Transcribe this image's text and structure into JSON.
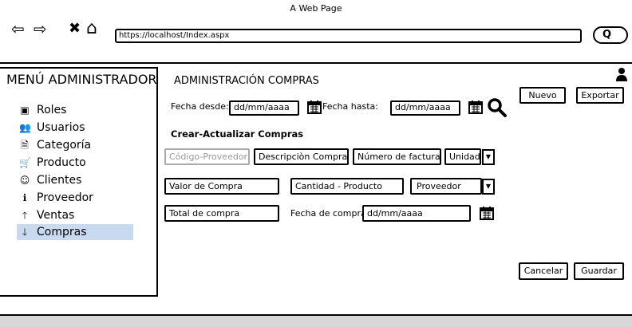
{
  "browser": {
    "title": "A Web Page",
    "url": "https://localhost/Index.aspx",
    "back_icon": "⇦",
    "forward_icon": "⇨",
    "close_icon": "✖",
    "home_icon": "⌂",
    "search_icon": "Q"
  },
  "sidebar": {
    "title": "MENÚ ADMINISTRADOR",
    "items": [
      {
        "label": "Roles",
        "icon": "▣"
      },
      {
        "label": "Usuarios",
        "icon": "👥"
      },
      {
        "label": "Categoría",
        "icon": "🗎"
      },
      {
        "label": "Producto",
        "icon": "🛒"
      },
      {
        "label": "Clientes",
        "icon": "☺"
      },
      {
        "label": "Proveedor",
        "icon": "ℹ"
      },
      {
        "label": "Ventas",
        "icon": "🡑"
      },
      {
        "label": "Compras",
        "icon": "🡓"
      }
    ],
    "active_color": "#c9d9f0"
  },
  "main": {
    "section_title": "ADMINISTRACIÓN COMPRAS",
    "fecha_desde_label": "Fecha desde:",
    "fecha_desde_value": "dd/mm/aaaa",
    "fecha_hasta_label": "Fecha hasta:",
    "fecha_hasta_value": "dd/mm/aaaa",
    "nuevo": "Nuevo",
    "exportar": "Exportar",
    "crear_actualizar": "Crear-Actualizar Compras",
    "codigo_proveedor": "Código-Proveedor",
    "descripcion_compra": "Descripciòn Compra",
    "numero_factura": "Número de factura",
    "unidad": "Unidad",
    "valor_compra": "Valor de Compra",
    "cantidad_producto": "Cantidad - Producto",
    "proveedor": "Proveedor",
    "total_compra": "Total de compra",
    "fecha_compra_label": "Fecha de compra",
    "fecha_compra_value": "dd/mm/aaaa",
    "cancelar": "Cancelar",
    "guardar": "Guardar"
  }
}
